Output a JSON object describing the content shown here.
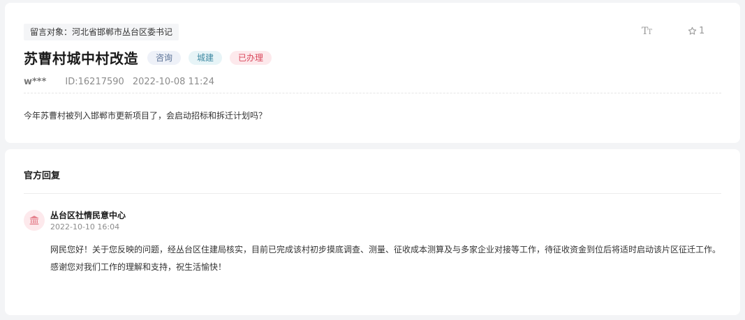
{
  "message": {
    "target": "留言对象：河北省邯郸市丛台区委书记",
    "title": "苏曹村城中村改造",
    "badges": {
      "type": "咨询",
      "category": "城建",
      "status": "已办理"
    },
    "user": "w***",
    "id": "ID:16217590",
    "datetime": "2022-10-08 11:24",
    "content": "今年苏曹村被列入邯郸市更新项目了，会启动招标和拆迁计划吗？"
  },
  "toolbar": {
    "font_icon": "font-size-icon",
    "font_label_big": "T",
    "font_label_small": "T",
    "favorite_icon": "star-icon",
    "favorite_count": "1"
  },
  "reply": {
    "section_title": "官方回复",
    "org_icon": "government-building-icon",
    "org_name": "丛台区社情民意中心",
    "datetime": "2022-10-10 16:04",
    "text": "网民您好！关于您反映的问题，经丛台区住建局核实，目前已完成该村初步摸底调查、测量、征收成本测算及与多家企业对接等工作，待征收资金到位后将适时启动该片区征迁工作。感谢您对我们工作的理解和支持，祝生活愉快！"
  },
  "colors": {
    "page_bg": "#f3f4f6",
    "status_red": "#d9485c",
    "category_teal": "#3f8aa3",
    "type_blue": "#5b7296"
  }
}
